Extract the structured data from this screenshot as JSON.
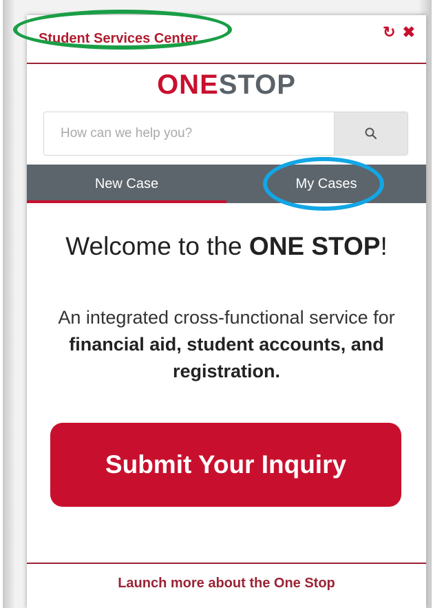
{
  "header": {
    "title": "Student Services Center",
    "icons": [
      "refresh-icon",
      "close-icon"
    ]
  },
  "logo": {
    "part1": "ONE",
    "part2": "STOP"
  },
  "search": {
    "placeholder": "How can we help you?",
    "icon": "search-icon"
  },
  "tabs": [
    {
      "label": "New Case",
      "active": true
    },
    {
      "label": "My Cases",
      "active": false
    }
  ],
  "welcome": {
    "prefix": "Welcome to the ",
    "emphasis": "ONE STOP",
    "suffix": "!"
  },
  "description": {
    "line1": "An integrated cross-functional service for",
    "bold": "financial aid, student accounts, and registration."
  },
  "submit_button": {
    "label": "Submit Your Inquiry"
  },
  "footer": {
    "link_label": "Launch more about the One Stop"
  },
  "colors": {
    "brand_red": "#c8102e",
    "dark_red": "#9b2335",
    "tab_gray": "#5c656c",
    "logo_gray": "#5a6268",
    "annotation_green": "#1a9e46",
    "annotation_blue": "#12a6e6"
  }
}
